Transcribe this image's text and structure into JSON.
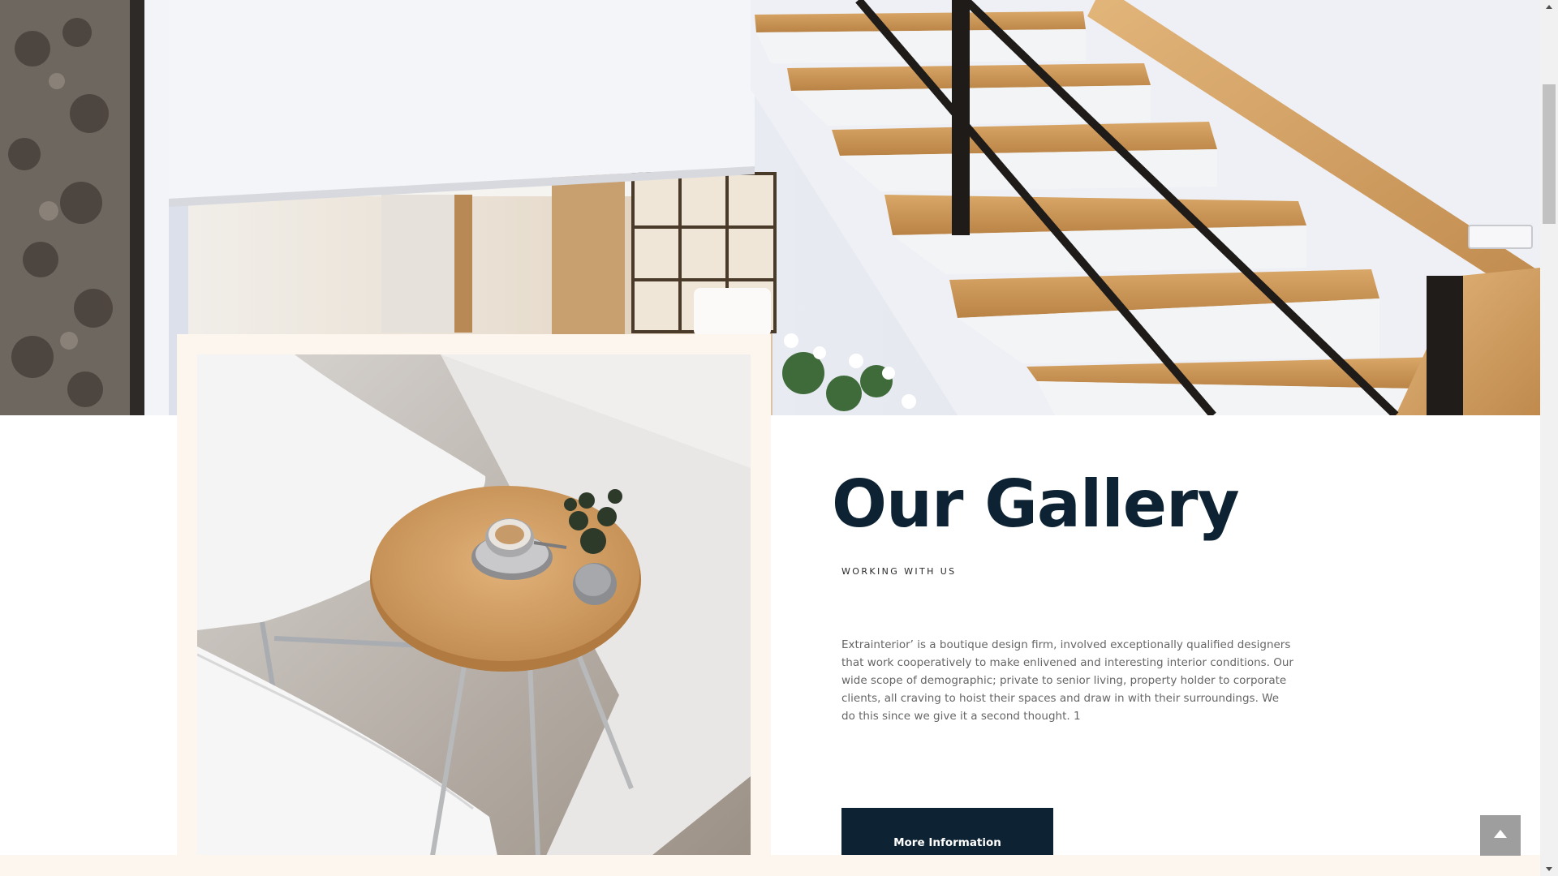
{
  "gallery": {
    "title": "Our Gallery",
    "subtitle": "WORKING WITH US",
    "body": "Extrainterior’ is a boutique design firm, involved exceptionally qualified designers that work cooperatively to make enlivened and interesting interior conditions. Our wide scope of demographic; private to senior living, property holder to corporate clients, all craving to hoist their spaces and draw in with their surroundings. We do this since we give it a second thought. 1",
    "button_label": "More Information"
  },
  "icons": {
    "back_to_top": "chevron-up-icon",
    "scroll_up": "scroll-up-arrow-icon",
    "scroll_down": "scroll-down-arrow-icon"
  },
  "colors": {
    "navy": "#0d2333",
    "cream": "#fdf6ef",
    "body_text": "#666666",
    "back_to_top_bg": "#9e9e9e"
  }
}
